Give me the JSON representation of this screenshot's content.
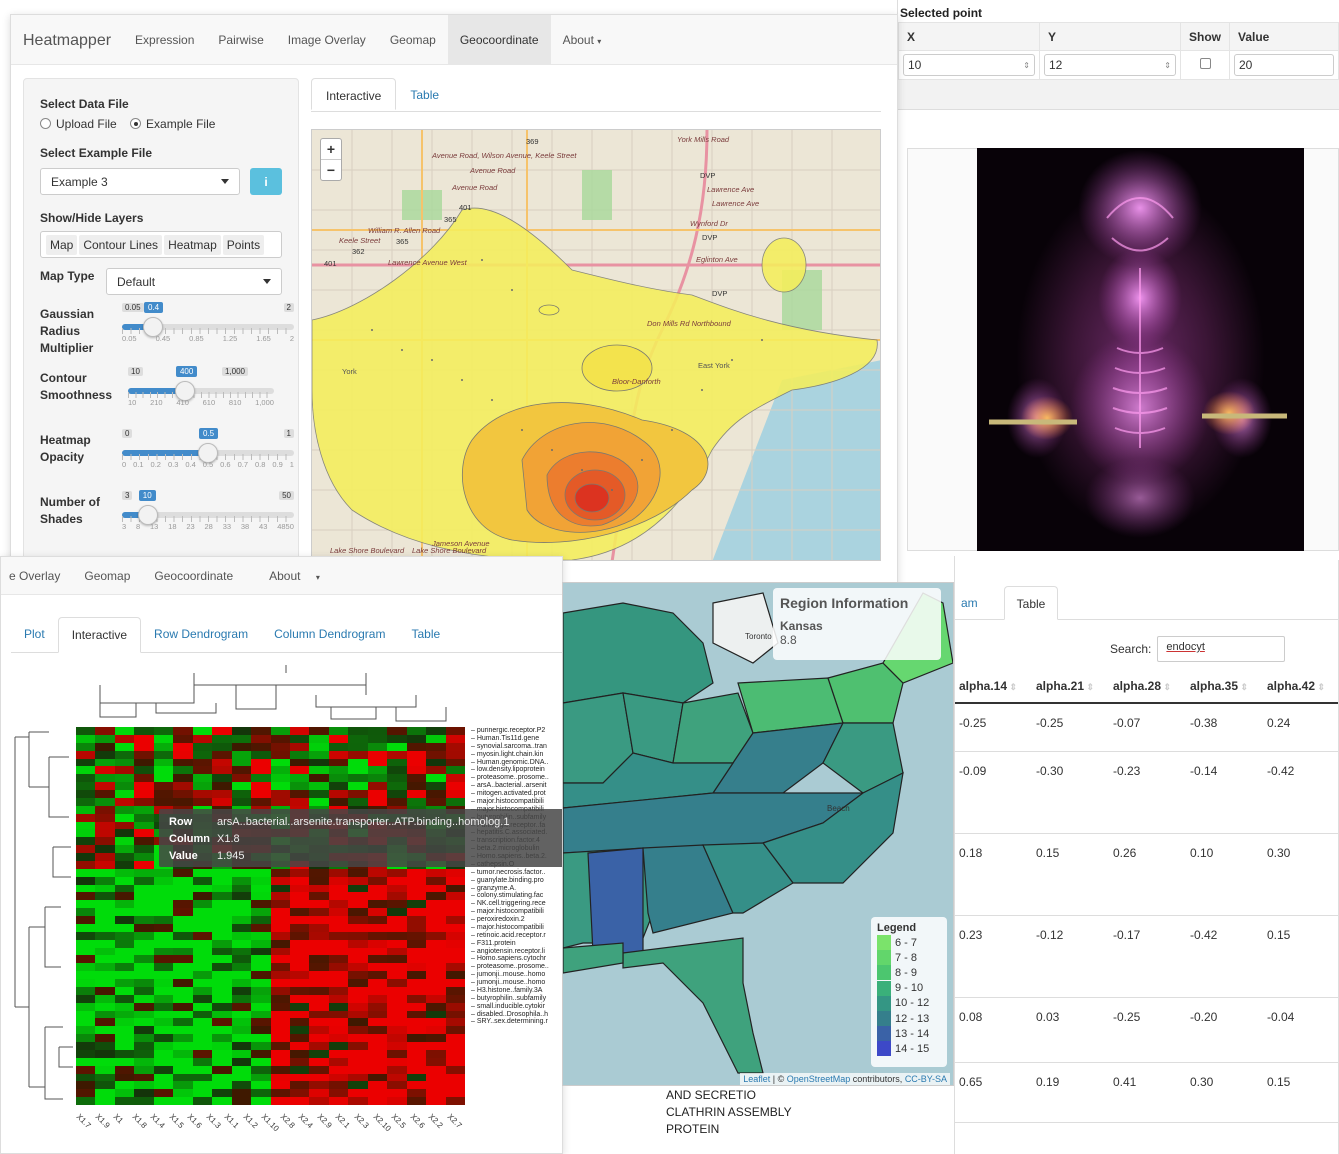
{
  "top_right": {
    "section_title": "Selected point",
    "headers": [
      "X",
      "Y",
      "Show",
      "Value"
    ],
    "x_value": "10",
    "y_value": "12",
    "value_value": "20"
  },
  "app1": {
    "brand": "Heatmapper",
    "nav": [
      "Expression",
      "Pairwise",
      "Image Overlay",
      "Geomap",
      "Geocoordinate",
      "About"
    ],
    "active_nav": "Geocoordinate",
    "select_data_file": "Select Data File",
    "upload_file": "Upload File",
    "example_file": "Example File",
    "select_example_file": "Select Example File",
    "example_value": "Example 3",
    "info_icon": "i",
    "show_hide_layers": "Show/Hide Layers",
    "layers": [
      "Map",
      "Contour Lines",
      "Heatmap",
      "Points"
    ],
    "map_type_label": "Map Type",
    "map_type_value": "Default",
    "sliders": [
      {
        "label": "Gaussian Radius Multiplier",
        "min": "0.05",
        "max": "2",
        "value": "0.4",
        "fraction": 0.18,
        "ticks": [
          "0.05",
          "0.45",
          "0.85",
          "1.25",
          "1.65",
          "2"
        ]
      },
      {
        "label": "Contour Smoothness",
        "min": "10",
        "max": "1,000",
        "value": "400",
        "fraction": 0.39,
        "ticks": [
          "10",
          "210",
          "410",
          "610",
          "810",
          "1,000"
        ]
      },
      {
        "label": "Heatmap Opacity",
        "min": "0",
        "max": "1",
        "value": "0.5",
        "fraction": 0.5,
        "ticks": [
          "0",
          "0.1",
          "0.2",
          "0.3",
          "0.4",
          "0.5",
          "0.6",
          "0.7",
          "0.8",
          "0.9",
          "1"
        ]
      },
      {
        "label": "Number of Shades",
        "min": "3",
        "max": "50",
        "value": "10",
        "fraction": 0.15,
        "ticks": [
          "3",
          "8",
          "13",
          "18",
          "23",
          "28",
          "33",
          "38",
          "43",
          "4850"
        ]
      }
    ],
    "tabs": [
      "Interactive",
      "Table"
    ],
    "zoom_in": "+",
    "zoom_out": "−",
    "map_labels": [
      "York Mills Road",
      "Avenue Road, Wilson Avenue, Keele Street",
      "Avenue Road",
      "Lawrence Ave",
      "Wynford Dr",
      "Eglinton Ave",
      "DVP",
      "William R. Allen Road",
      "Keele Street",
      "Lawrence Avenue West",
      "Don Mills Rd Northbound",
      "York",
      "East York",
      "Bloor-Danforth",
      "Jameson Avenue",
      "Lake Shore Boulevard",
      "401",
      "365",
      "362",
      "369"
    ]
  },
  "app2": {
    "nav": [
      "e Overlay",
      "Geomap",
      "Geocoordinate",
      "About"
    ],
    "tabs": [
      "Plot",
      "Interactive",
      "Row Dendrogram",
      "Column Dendrogram",
      "Table"
    ],
    "active_tab": "Interactive",
    "tooltip": {
      "row_label": "Row",
      "row_value": "arsA..bacterial..arsenite.transporter..ATP.binding..homolog.1",
      "col_label": "Column",
      "col_value": "X1.8",
      "val_label": "Value",
      "val_value": "1.945"
    },
    "row_labels": [
      "purinergic.receptor.P2",
      "Human.Tis11d.gene",
      "synovial.sarcoma..tran",
      "myosin.light.chain.kin",
      "Human.genomic.DNA..",
      "low.density.lipoprotein",
      "proteasome..prosome..",
      "arsA..bacterial..arsenit",
      "mitogen.activated.prot",
      "",
      "",
      "",
      "",
      "",
      "",
      "",
      "",
      "major.histocompatibili",
      "major.histocompatibili",
      "butyrophilin..subfamily",
      "Purinergic.receptor..fa",
      "hepatitis.C.associated.",
      "transcription.factor.4",
      "beta.2.microglobulin",
      "Homo.sapiens..beta.2.",
      "cathepsin.O",
      "tumor.necrosis.factor..",
      "guanylate.binding.pro",
      "granzyme.A.",
      "colony.stimulating.fac",
      "NK.cell.triggering.rece",
      "major.histocompatibili",
      "peroxiredoxin.2",
      "major.histocompatibili",
      "retinoic.acid.receptor.r",
      "F311.protein",
      "angiotensin.receptor.li",
      "Homo.sapiens.cytochr",
      "proteasome..prosome..",
      "jumonji..mouse..homo",
      "jumonji..mouse..homo",
      "H3.histone..family.3A",
      "butyrophilin..subfamily",
      "small.inducible.cytokir",
      "disabled..Drosophila..h",
      "SRY..sex.determining.r",
      "",
      ""
    ],
    "col_labels": [
      "X1.7",
      "X1.9",
      "X1",
      "X1.8",
      "X1.4",
      "X1.5",
      "X1.6",
      "X1.3",
      "X1.1",
      "X1.2",
      "X1.10",
      "X2.8",
      "X2.4",
      "X2.9",
      "X2.1",
      "X2.3",
      "X2.10",
      "X2.5",
      "X2.6",
      "X2.2",
      "X2.7"
    ]
  },
  "usa_map": {
    "title": "Region Information",
    "region": "Kansas",
    "value": "8.8",
    "city_labels": [
      "Toronto",
      "Beach"
    ],
    "legend_title": "Legend",
    "legend": [
      {
        "label": "6 - 7",
        "color": "#7be36b"
      },
      {
        "label": "7 - 8",
        "color": "#62d66b"
      },
      {
        "label": "8 - 9",
        "color": "#4cc66f"
      },
      {
        "label": "9 - 10",
        "color": "#3ab07a"
      },
      {
        "label": "10 - 12",
        "color": "#349684"
      },
      {
        "label": "12 - 13",
        "color": "#357f8c"
      },
      {
        "label": "13 - 14",
        "color": "#3a62a7"
      },
      {
        "label": "14 - 15",
        "color": "#3d49c8"
      }
    ],
    "attribution_leaflet": "Leaflet",
    "attribution_sep": " | © ",
    "attribution_osm": "OpenStreetMap",
    "attribution_rest": " contributors, ",
    "attribution_cc": "CC-BY-SA"
  },
  "table_panel": {
    "tab_partial": "am",
    "tab_active": "Table",
    "search_label": "Search:",
    "search_value": "endocyt",
    "columns": [
      "alpha.14",
      "alpha.21",
      "alpha.28",
      "alpha.35",
      "alpha.42"
    ],
    "rows": [
      [
        "-0.25",
        "-0.25",
        "-0.07",
        "-0.38",
        "0.24"
      ],
      [
        "-0.09",
        "-0.30",
        "-0.23",
        "-0.14",
        "-0.42"
      ],
      [
        "0.18",
        "0.15",
        "0.26",
        "0.10",
        "0.30"
      ],
      [
        "0.23",
        "-0.12",
        "-0.17",
        "-0.42",
        "0.15"
      ],
      [
        "0.08",
        "0.03",
        "-0.25",
        "-0.20",
        "-0.04"
      ],
      [
        "0.65",
        "0.19",
        "0.41",
        "0.30",
        "0.15"
      ]
    ],
    "left_text": [
      "AND SECRETIO",
      "CLATHRIN ASSEMBLY",
      "PROTEIN"
    ]
  }
}
